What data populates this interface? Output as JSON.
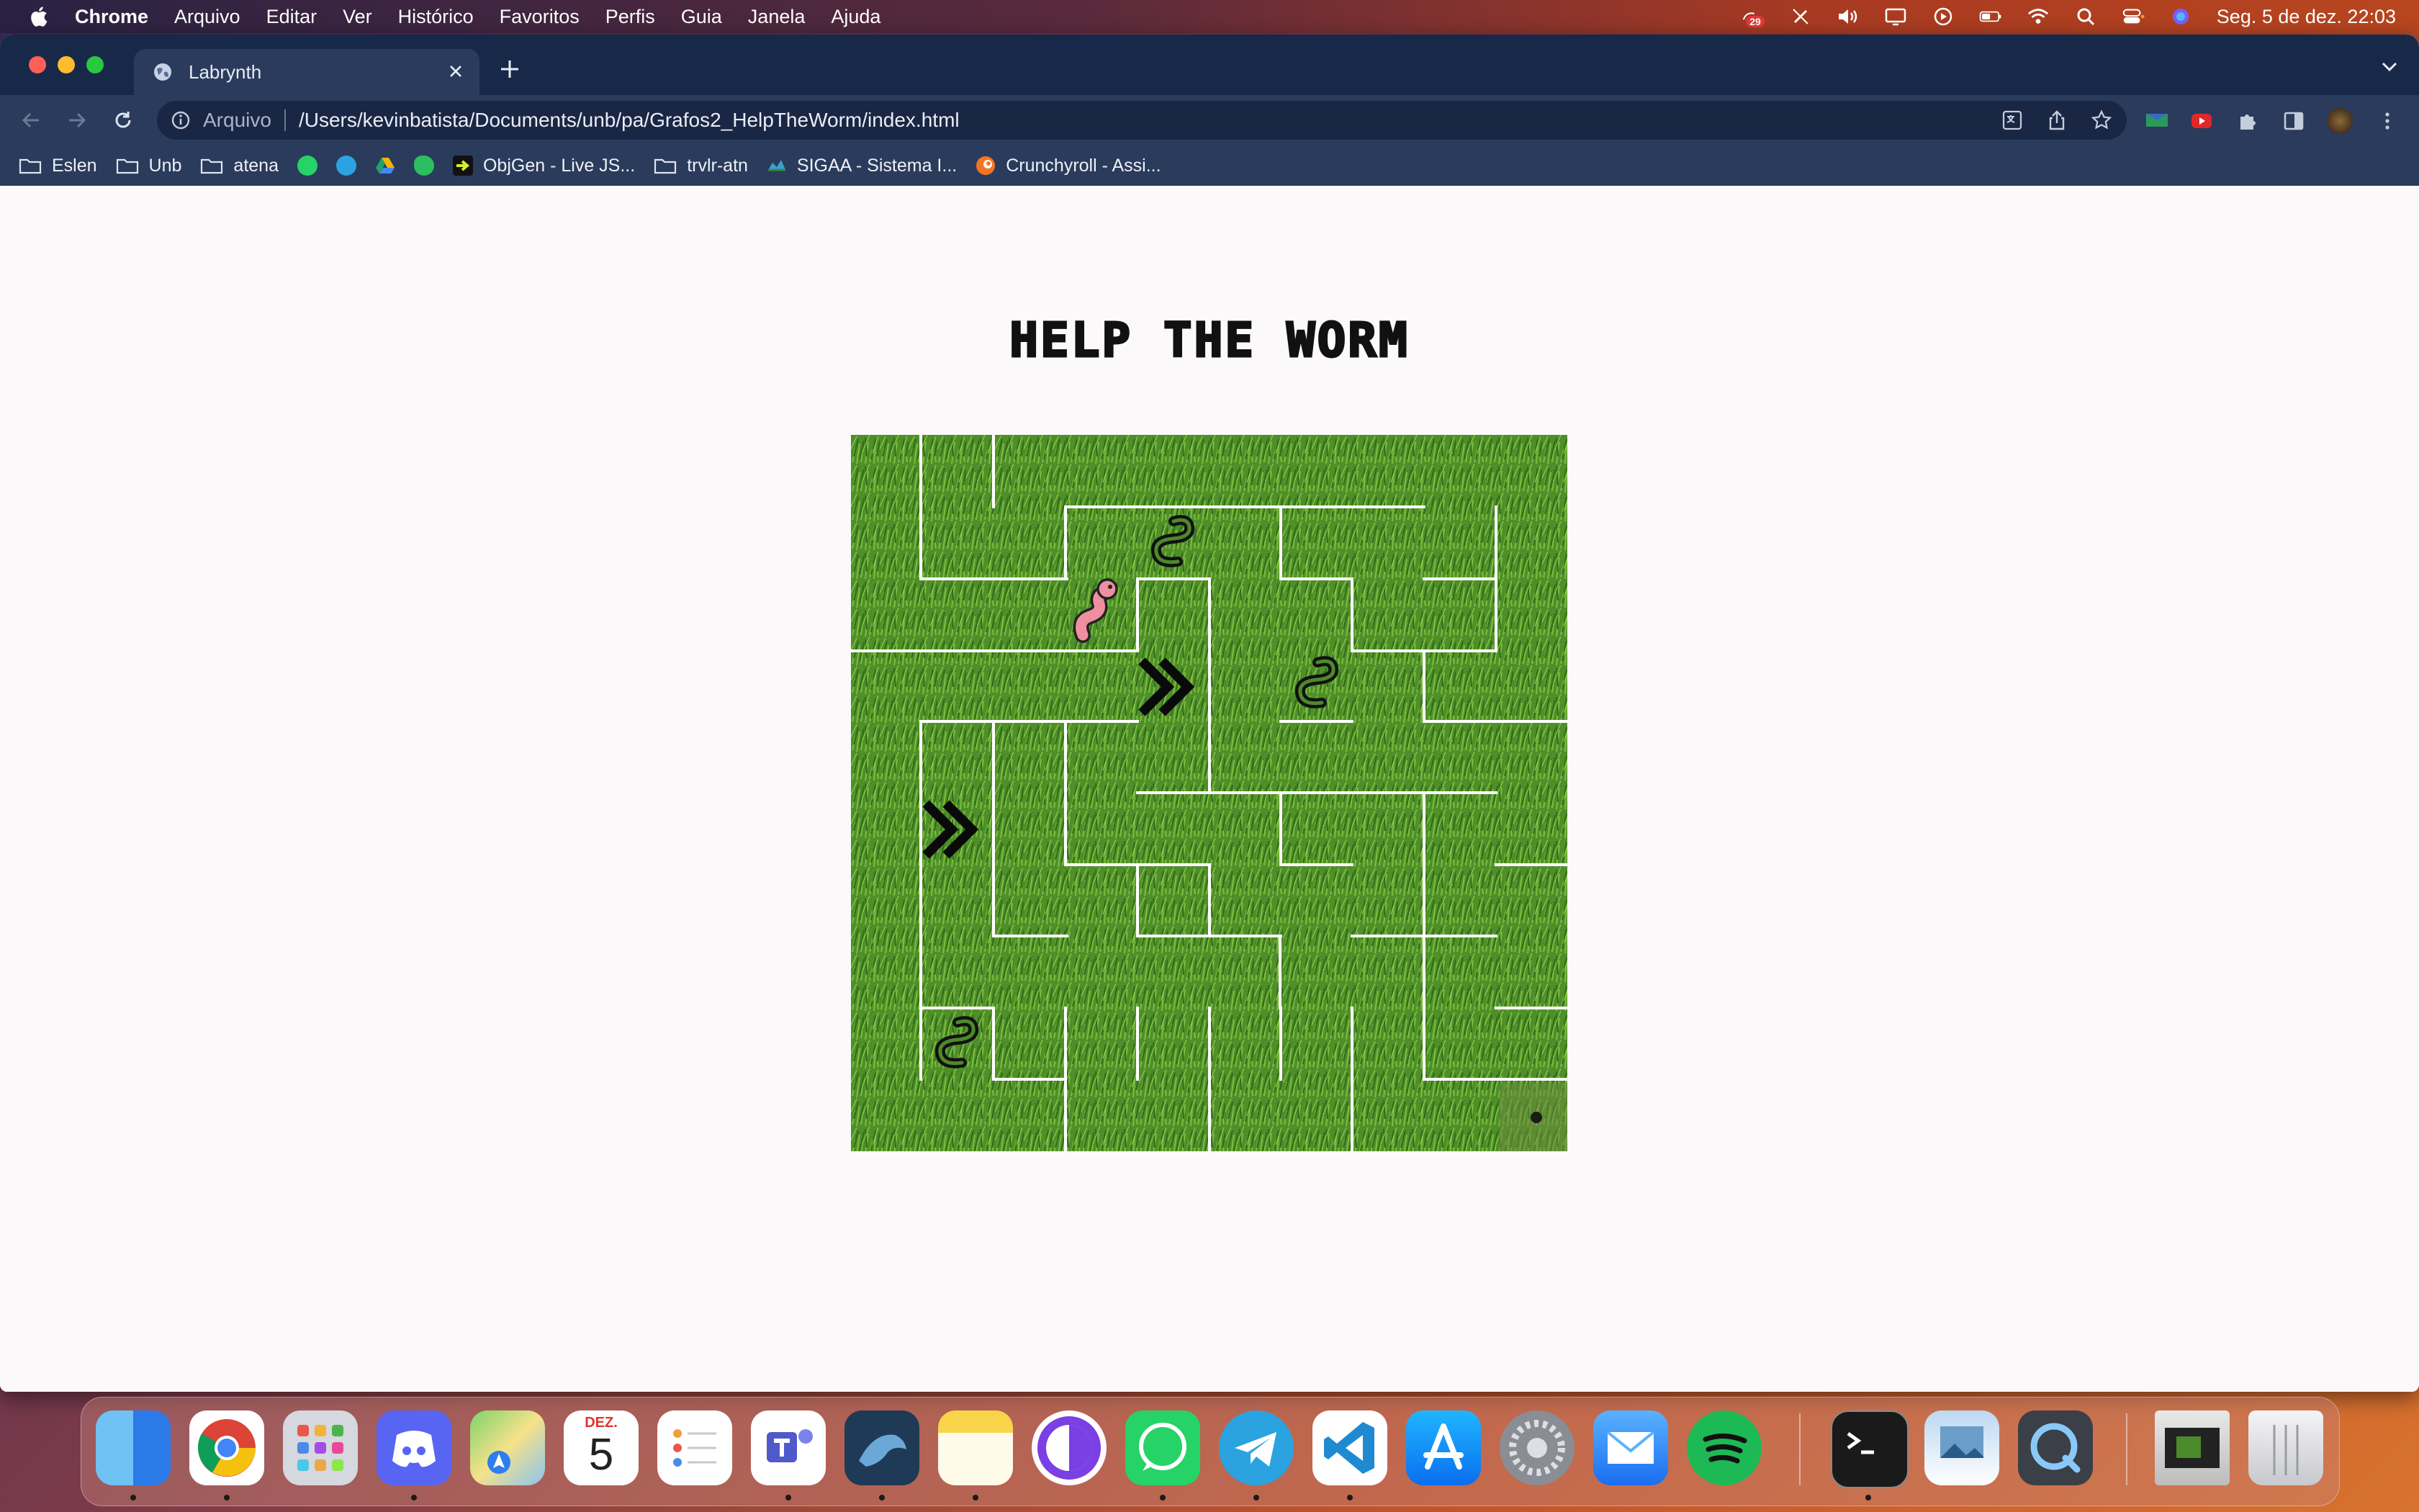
{
  "menubar": {
    "app": "Chrome",
    "items": [
      "Arquivo",
      "Editar",
      "Ver",
      "Histórico",
      "Favoritos",
      "Perfis",
      "Guia",
      "Janela",
      "Ajuda"
    ],
    "badge": "29",
    "datetime": "Seg. 5 de dez.  22:03"
  },
  "browser": {
    "tab_title": "Labrynth",
    "url_scheme": "Arquivo",
    "url": "/Users/kevinbatista/Documents/unb/pa/Grafos2_HelpTheWorm/index.html",
    "bookmarks": [
      {
        "label": "Eslen",
        "icon": "folder-icon"
      },
      {
        "label": "Unb",
        "icon": "folder-icon"
      },
      {
        "label": "atena",
        "icon": "folder-icon"
      },
      {
        "label": "",
        "icon": "whatsapp-icon"
      },
      {
        "label": "",
        "icon": "telegram-icon"
      },
      {
        "label": "",
        "icon": "google-drive-icon"
      },
      {
        "label": "",
        "icon": "evernote-icon"
      },
      {
        "label": "ObjGen - Live JS...",
        "icon": "objgen-icon"
      },
      {
        "label": "trvlr-atn",
        "icon": "folder-icon"
      },
      {
        "label": "SIGAA - Sistema I...",
        "icon": "sigaa-icon"
      },
      {
        "label": "Crunchyroll - Assi...",
        "icon": "crunchyroll-icon"
      }
    ]
  },
  "page": {
    "title": "HELP THE WORM"
  },
  "dock": {
    "apps": [
      "Finder",
      "Chrome",
      "Launchpad",
      "Discord",
      "Maps",
      "Calendar",
      "Reminders",
      "Teams",
      "MySQL Workbench",
      "Notes",
      "Tor",
      "WhatsApp",
      "Telegram",
      "VS Code",
      "App Store",
      "System Preferences",
      "Mail",
      "Spotify",
      "Terminal",
      "Preview",
      "QuickTime",
      "Downloads",
      "Trash"
    ],
    "calendar_month": "DEZ.",
    "calendar_day": "5"
  },
  "colors": {
    "menubar": "#5a2a3c",
    "tabstrip": "#182848",
    "toolbar": "#2a3b5c",
    "page_bg": "#fbf9f9",
    "grass": "#4a8a2a",
    "maze_wall": "#ffffff",
    "worm": "#e98a9c"
  }
}
